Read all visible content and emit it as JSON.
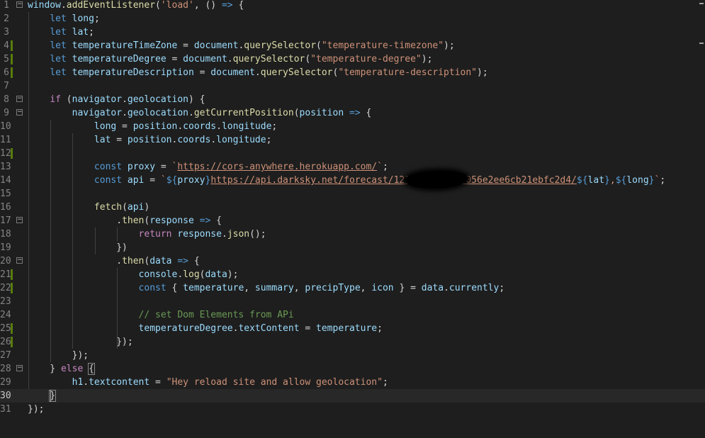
{
  "editor": {
    "lines": [
      {
        "n": "1",
        "fold": true,
        "mod": false,
        "t": [
          [
            "v",
            "window"
          ],
          [
            "p",
            "."
          ],
          [
            "f",
            "addEventListener"
          ],
          [
            "p",
            "("
          ],
          [
            "s",
            "'load'"
          ],
          [
            "p",
            ", () "
          ],
          [
            "k",
            "=>"
          ],
          [
            "p",
            " {"
          ]
        ]
      },
      {
        "n": "2",
        "fold": false,
        "mod": false,
        "t": [
          [
            "p",
            "    "
          ],
          [
            "k",
            "let"
          ],
          [
            "p",
            " "
          ],
          [
            "v",
            "long"
          ],
          [
            "p",
            ";"
          ]
        ]
      },
      {
        "n": "3",
        "fold": false,
        "mod": false,
        "t": [
          [
            "p",
            "    "
          ],
          [
            "k",
            "let"
          ],
          [
            "p",
            " "
          ],
          [
            "v",
            "lat"
          ],
          [
            "p",
            ";"
          ]
        ]
      },
      {
        "n": "4",
        "fold": false,
        "mod": true,
        "t": [
          [
            "p",
            "    "
          ],
          [
            "k",
            "let"
          ],
          [
            "p",
            " "
          ],
          [
            "v",
            "temperatureTimeZone"
          ],
          [
            "p",
            " = "
          ],
          [
            "v",
            "document"
          ],
          [
            "p",
            "."
          ],
          [
            "f",
            "querySelector"
          ],
          [
            "p",
            "("
          ],
          [
            "s",
            "\"temperature-timezone\""
          ],
          [
            "p",
            ");"
          ]
        ]
      },
      {
        "n": "5",
        "fold": false,
        "mod": true,
        "t": [
          [
            "p",
            "    "
          ],
          [
            "k",
            "let"
          ],
          [
            "p",
            " "
          ],
          [
            "v",
            "temperatureDegree"
          ],
          [
            "p",
            " = "
          ],
          [
            "v",
            "document"
          ],
          [
            "p",
            "."
          ],
          [
            "f",
            "querySelector"
          ],
          [
            "p",
            "("
          ],
          [
            "s",
            "\"temperature-degree\""
          ],
          [
            "p",
            ");"
          ]
        ]
      },
      {
        "n": "6",
        "fold": false,
        "mod": true,
        "t": [
          [
            "p",
            "    "
          ],
          [
            "k",
            "let"
          ],
          [
            "p",
            " "
          ],
          [
            "v",
            "temperatureDescription"
          ],
          [
            "p",
            " = "
          ],
          [
            "v",
            "document"
          ],
          [
            "p",
            "."
          ],
          [
            "f",
            "querySelector"
          ],
          [
            "p",
            "("
          ],
          [
            "s",
            "\"temperature-description\""
          ],
          [
            "p",
            ");"
          ]
        ]
      },
      {
        "n": "7",
        "fold": false,
        "mod": false,
        "t": []
      },
      {
        "n": "8",
        "fold": true,
        "mod": false,
        "t": [
          [
            "p",
            "    "
          ],
          [
            "kc",
            "if"
          ],
          [
            "p",
            " ("
          ],
          [
            "v",
            "navigator"
          ],
          [
            "p",
            "."
          ],
          [
            "v",
            "geolocation"
          ],
          [
            "p",
            ") {"
          ]
        ]
      },
      {
        "n": "9",
        "fold": true,
        "mod": false,
        "t": [
          [
            "p",
            "        "
          ],
          [
            "v",
            "navigator"
          ],
          [
            "p",
            "."
          ],
          [
            "v",
            "geolocation"
          ],
          [
            "p",
            "."
          ],
          [
            "f",
            "getCurrentPosition"
          ],
          [
            "p",
            "("
          ],
          [
            "v",
            "position"
          ],
          [
            "p",
            " "
          ],
          [
            "k",
            "=>"
          ],
          [
            "p",
            " {"
          ]
        ]
      },
      {
        "n": "10",
        "fold": false,
        "mod": false,
        "t": [
          [
            "p",
            "            "
          ],
          [
            "v",
            "long"
          ],
          [
            "p",
            " = "
          ],
          [
            "v",
            "position"
          ],
          [
            "p",
            "."
          ],
          [
            "v",
            "coords"
          ],
          [
            "p",
            "."
          ],
          [
            "v",
            "longitude"
          ],
          [
            "p",
            ";"
          ]
        ]
      },
      {
        "n": "11",
        "fold": false,
        "mod": false,
        "t": [
          [
            "p",
            "            "
          ],
          [
            "v",
            "lat"
          ],
          [
            "p",
            " = "
          ],
          [
            "v",
            "position"
          ],
          [
            "p",
            "."
          ],
          [
            "v",
            "coords"
          ],
          [
            "p",
            "."
          ],
          [
            "v",
            "longitude"
          ],
          [
            "p",
            ";"
          ]
        ]
      },
      {
        "n": "12",
        "fold": false,
        "mod": true,
        "t": []
      },
      {
        "n": "13",
        "fold": false,
        "mod": false,
        "t": [
          [
            "p",
            "            "
          ],
          [
            "k",
            "const"
          ],
          [
            "p",
            " "
          ],
          [
            "v",
            "proxy"
          ],
          [
            "p",
            " = "
          ],
          [
            "s",
            "`"
          ],
          [
            "u",
            "https://cors-anywhere.herokuapp.com/"
          ],
          [
            "s",
            "`"
          ],
          [
            "p",
            ";"
          ]
        ]
      },
      {
        "n": "14",
        "fold": false,
        "mod": false,
        "t": [
          [
            "p",
            "            "
          ],
          [
            "k",
            "const"
          ],
          [
            "p",
            " "
          ],
          [
            "v",
            "api"
          ],
          [
            "p",
            " = "
          ],
          [
            "s",
            "`"
          ],
          [
            "t",
            "${"
          ],
          [
            "v",
            "proxy"
          ],
          [
            "t",
            "}"
          ],
          [
            "u",
            "https://api.darksky.net/forecast/123"
          ],
          [
            "p",
            "        "
          ],
          [
            "u",
            "a7056e2ee6cb21ebfc2d4/"
          ],
          [
            "t",
            "${"
          ],
          [
            "v",
            "lat"
          ],
          [
            "t",
            "}"
          ],
          [
            "s",
            ","
          ],
          [
            "t",
            "${"
          ],
          [
            "v",
            "long"
          ],
          [
            "t",
            "}"
          ],
          [
            "s",
            "`"
          ],
          [
            "p",
            ";"
          ]
        ]
      },
      {
        "n": "15",
        "fold": false,
        "mod": false,
        "t": []
      },
      {
        "n": "16",
        "fold": false,
        "mod": false,
        "t": [
          [
            "p",
            "            "
          ],
          [
            "f",
            "fetch"
          ],
          [
            "p",
            "("
          ],
          [
            "v",
            "api"
          ],
          [
            "p",
            ")"
          ]
        ]
      },
      {
        "n": "17",
        "fold": true,
        "mod": false,
        "t": [
          [
            "p",
            "                ."
          ],
          [
            "f",
            "then"
          ],
          [
            "p",
            "("
          ],
          [
            "v",
            "response"
          ],
          [
            "p",
            " "
          ],
          [
            "k",
            "=>"
          ],
          [
            "p",
            " {"
          ]
        ]
      },
      {
        "n": "18",
        "fold": false,
        "mod": false,
        "t": [
          [
            "p",
            "                    "
          ],
          [
            "kc",
            "return"
          ],
          [
            "p",
            " "
          ],
          [
            "v",
            "response"
          ],
          [
            "p",
            "."
          ],
          [
            "f",
            "json"
          ],
          [
            "p",
            "();"
          ]
        ]
      },
      {
        "n": "19",
        "fold": false,
        "mod": false,
        "t": [
          [
            "p",
            "                })"
          ]
        ]
      },
      {
        "n": "20",
        "fold": true,
        "mod": false,
        "t": [
          [
            "p",
            "                ."
          ],
          [
            "f",
            "then"
          ],
          [
            "p",
            "("
          ],
          [
            "v",
            "data"
          ],
          [
            "p",
            " "
          ],
          [
            "k",
            "=>"
          ],
          [
            "p",
            " {"
          ]
        ]
      },
      {
        "n": "21",
        "fold": false,
        "mod": true,
        "t": [
          [
            "p",
            "                    "
          ],
          [
            "v",
            "console"
          ],
          [
            "p",
            "."
          ],
          [
            "f",
            "log"
          ],
          [
            "p",
            "("
          ],
          [
            "v",
            "data"
          ],
          [
            "p",
            ");"
          ]
        ]
      },
      {
        "n": "22",
        "fold": false,
        "mod": true,
        "t": [
          [
            "p",
            "                    "
          ],
          [
            "k",
            "const"
          ],
          [
            "p",
            " { "
          ],
          [
            "v",
            "temperature"
          ],
          [
            "p",
            ", "
          ],
          [
            "v",
            "summary"
          ],
          [
            "p",
            ", "
          ],
          [
            "v",
            "precipType"
          ],
          [
            "p",
            ", "
          ],
          [
            "v",
            "icon"
          ],
          [
            "p",
            " } = "
          ],
          [
            "v",
            "data"
          ],
          [
            "p",
            "."
          ],
          [
            "v",
            "currently"
          ],
          [
            "p",
            ";"
          ]
        ]
      },
      {
        "n": "23",
        "fold": false,
        "mod": false,
        "t": []
      },
      {
        "n": "24",
        "fold": false,
        "mod": false,
        "t": [
          [
            "p",
            "                    "
          ],
          [
            "c",
            "// set Dom Elements from APi"
          ]
        ]
      },
      {
        "n": "25",
        "fold": false,
        "mod": true,
        "t": [
          [
            "p",
            "                    "
          ],
          [
            "v",
            "temperatureDegree"
          ],
          [
            "p",
            "."
          ],
          [
            "v",
            "textContent"
          ],
          [
            "p",
            " = "
          ],
          [
            "v",
            "temperature"
          ],
          [
            "p",
            ";"
          ]
        ]
      },
      {
        "n": "26",
        "fold": false,
        "mod": true,
        "t": [
          [
            "p",
            "                });"
          ]
        ]
      },
      {
        "n": "27",
        "fold": false,
        "mod": false,
        "t": [
          [
            "p",
            "        });"
          ]
        ]
      },
      {
        "n": "28",
        "fold": true,
        "mod": false,
        "t": [
          [
            "p",
            "    } "
          ],
          [
            "kc",
            "else"
          ],
          [
            "p",
            " "
          ],
          [
            "bm",
            "{"
          ]
        ]
      },
      {
        "n": "29",
        "fold": false,
        "mod": false,
        "t": [
          [
            "p",
            "        "
          ],
          [
            "v",
            "h1"
          ],
          [
            "p",
            "."
          ],
          [
            "v",
            "textcontent"
          ],
          [
            "p",
            " = "
          ],
          [
            "s",
            "\"Hey reload site and allow geolocation\""
          ],
          [
            "p",
            ";"
          ]
        ]
      },
      {
        "n": "30",
        "fold": false,
        "mod": false,
        "current": true,
        "t": [
          [
            "p",
            "    "
          ],
          [
            "bm",
            "}"
          ]
        ]
      },
      {
        "n": "31",
        "fold": false,
        "mod": false,
        "t": [
          [
            "p",
            "});"
          ]
        ]
      }
    ]
  },
  "colors": {
    "background": "#1e1e1e",
    "keyword": "#569cd6",
    "control": "#c586c0",
    "variable": "#9cdcfe",
    "function": "#dcdcaa",
    "string": "#ce9178",
    "comment": "#6a9955",
    "modified": "#587c0c"
  },
  "icons": [
    "fold-toggle-icon",
    "redaction-mark"
  ]
}
